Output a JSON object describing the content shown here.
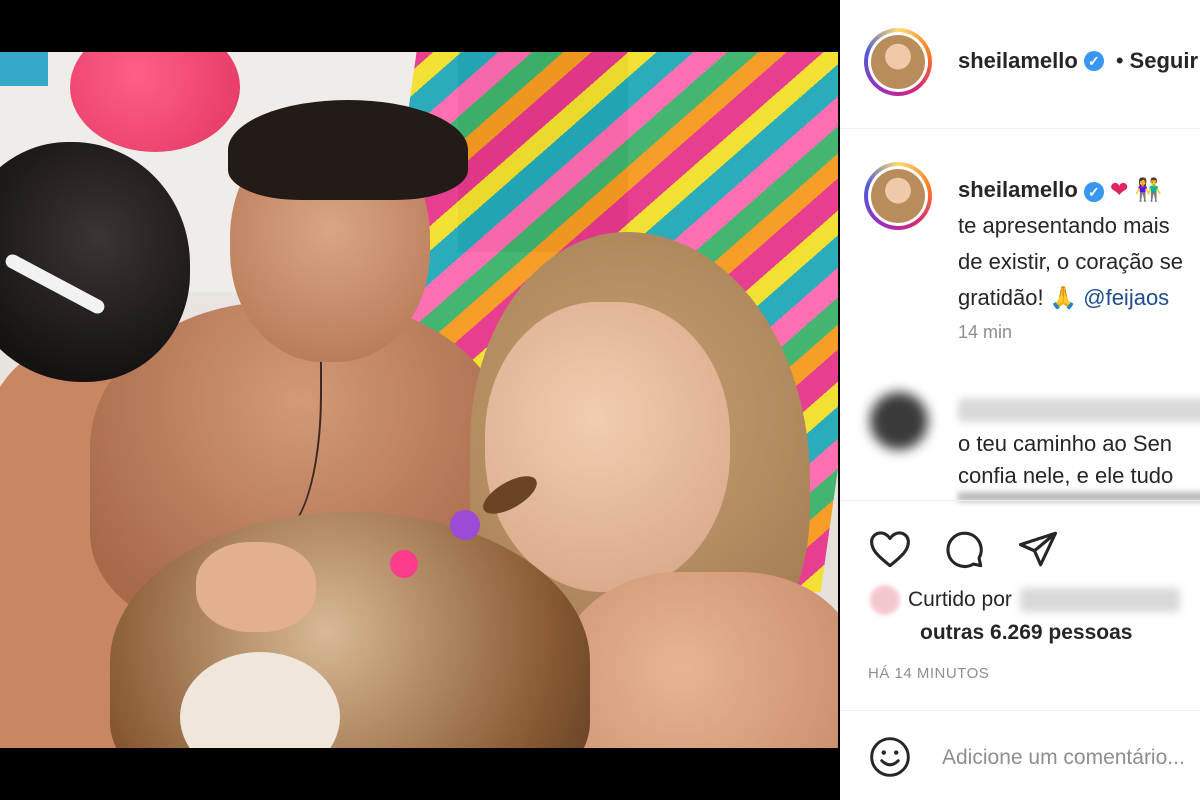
{
  "post": {
    "username": "sheilamello",
    "follow_separator": "•",
    "follow_label": "Seguir"
  },
  "caption": {
    "username": "sheilamello",
    "emojis": "❤ 👫",
    "lines": [
      "te apresentando mais",
      "de existir, o coração se",
      "gratidão! 🙏"
    ],
    "mention": "@feijaos"
  },
  "caption_time": "14 min",
  "comment": {
    "lines": [
      "o teu caminho ao Sen",
      "confia nele, e ele tudo"
    ]
  },
  "actions": {
    "liked_by_label": "Curtido por",
    "likes_text": "outras 6.269 pessoas",
    "time_ago": "HÁ 14 MINUTOS"
  },
  "add_comment": {
    "placeholder": "Adicione um comentário..."
  },
  "colors": {
    "verified": "#3897f0",
    "text": "#262626",
    "muted": "#8e8e8e"
  }
}
